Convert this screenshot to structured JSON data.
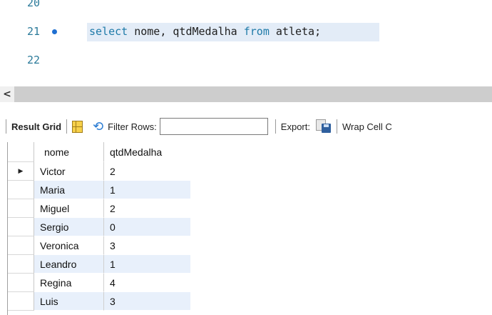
{
  "editor": {
    "lines": [
      {
        "number": "20",
        "code": ""
      },
      {
        "number": "21",
        "code_keyword1": "select",
        "code_mid": " nome, qtdMedalha ",
        "code_keyword2": "from",
        "code_tail": " atleta;"
      },
      {
        "number": "22",
        "code": ""
      }
    ]
  },
  "scrollbar": {
    "left_arrow": "<"
  },
  "toolbar": {
    "result_grid_label": "Result Grid",
    "filter_label": "Filter Rows:",
    "filter_value": "",
    "export_label": "Export:",
    "wrap_label": "Wrap Cell C"
  },
  "grid": {
    "columns": [
      "nome",
      "qtdMedalha"
    ],
    "current_row_marker": "▶",
    "rows": [
      {
        "nome": "Victor",
        "qtdMedalha": "2"
      },
      {
        "nome": "Maria",
        "qtdMedalha": "1"
      },
      {
        "nome": "Miguel",
        "qtdMedalha": "2"
      },
      {
        "nome": "Sergio",
        "qtdMedalha": "0"
      },
      {
        "nome": "Veronica",
        "qtdMedalha": "3"
      },
      {
        "nome": "Leandro",
        "qtdMedalha": "1"
      },
      {
        "nome": "Regina",
        "qtdMedalha": "4"
      },
      {
        "nome": "Luis",
        "qtdMedalha": "3"
      }
    ]
  },
  "colors": {
    "keyword": "#1e7aa8",
    "line_number": "#2b7a9a",
    "selected_line_bg": "#e3ecf7",
    "alt_row_bg": "#e8f0fb"
  },
  "icons": {
    "bookmark": "dot-icon",
    "grid_toggle": "grid-icon",
    "refresh": "refresh-icon",
    "export": "export-file-icon"
  }
}
